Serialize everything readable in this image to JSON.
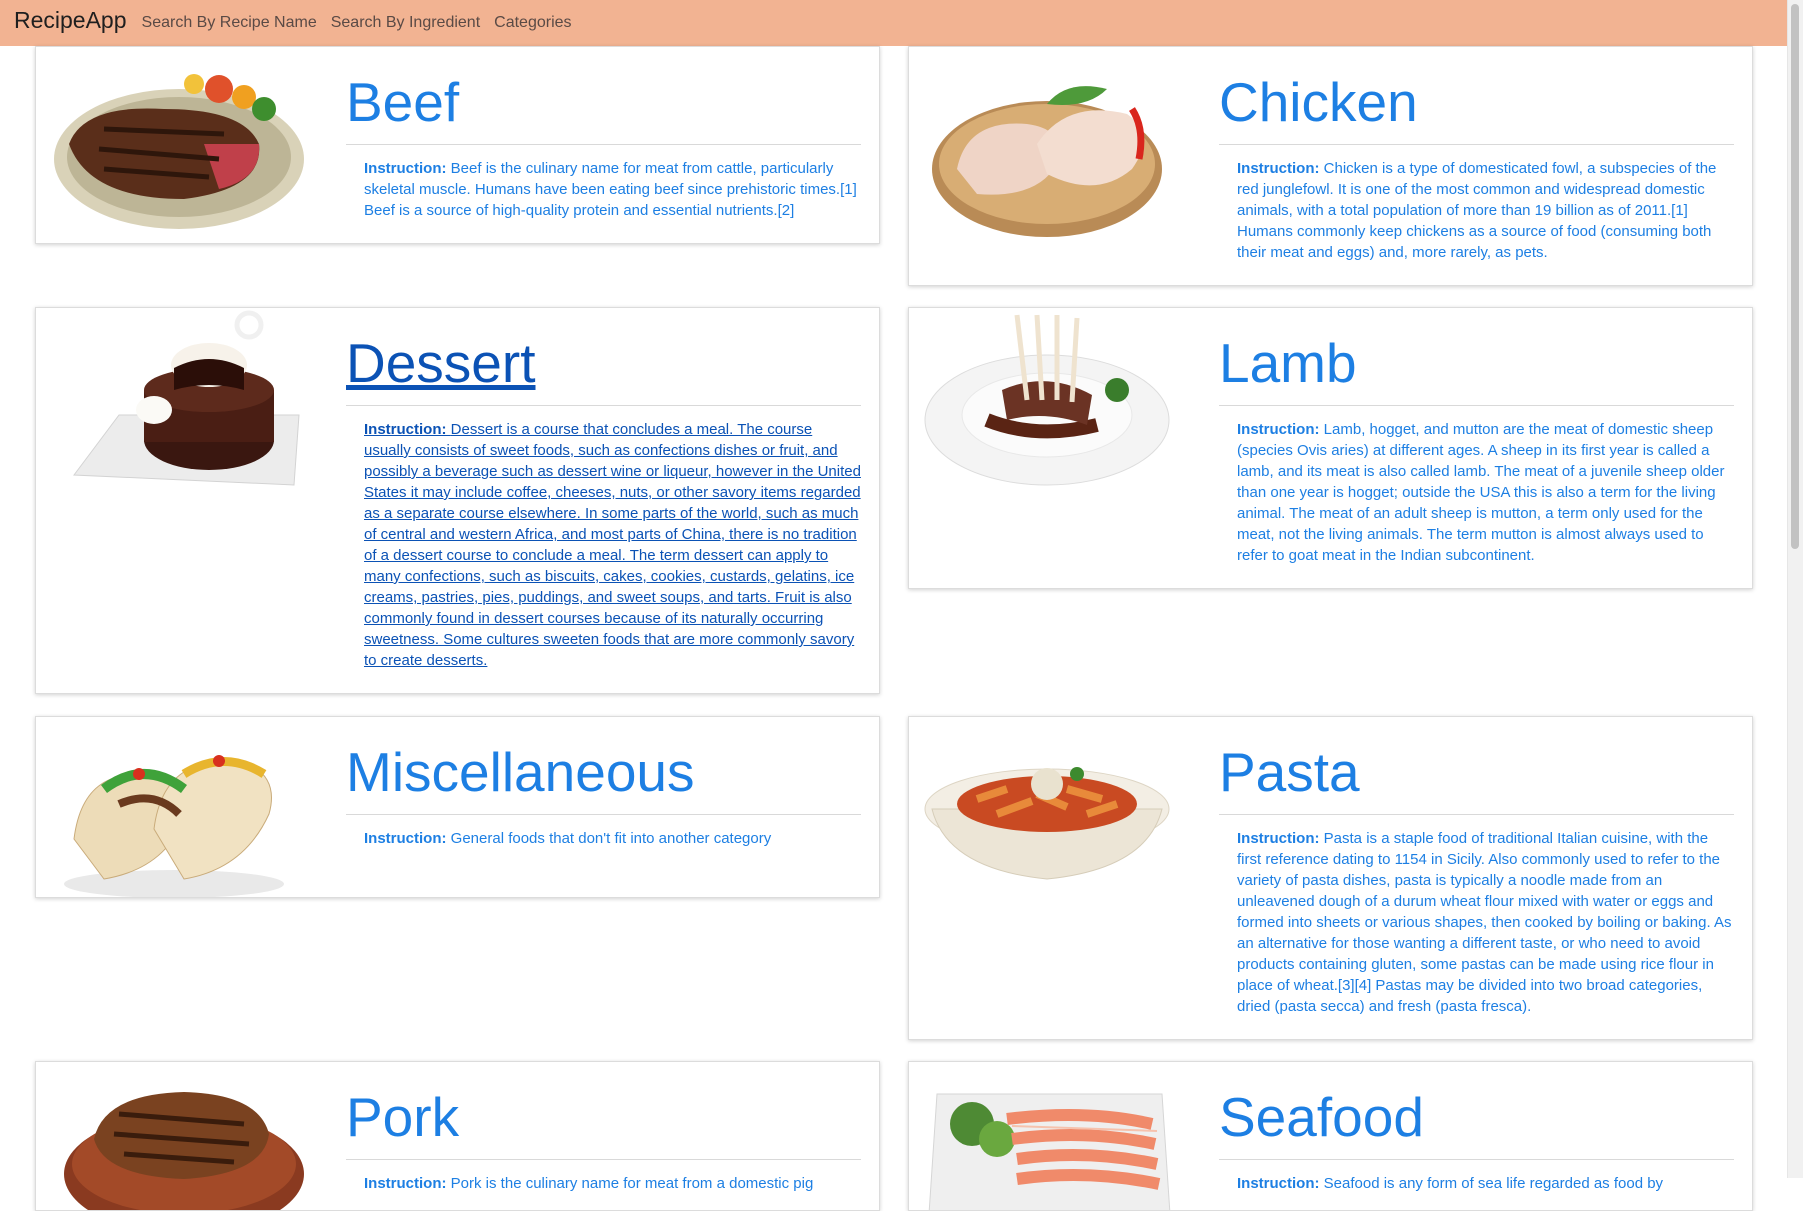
{
  "app": {
    "brand": "RecipeApp",
    "nav": [
      "Search By Recipe Name",
      "Search By Ingredient",
      "Categories"
    ]
  },
  "instruction_label": "Instruction:",
  "categories": [
    {
      "name": "Beef",
      "image_icon": "steak-plate-icon",
      "instruction": "Beef is the culinary name for meat from cattle, particularly skeletal muscle. Humans have been eating beef since prehistoric times.[1] Beef is a source of high-quality protein and essential nutrients.[2]"
    },
    {
      "name": "Chicken",
      "image_icon": "chicken-legs-icon",
      "instruction": "Chicken is a type of domesticated fowl, a subspecies of the red junglefowl. It is one of the most common and widespread domestic animals, with a total population of more than 19 billion as of 2011.[1] Humans commonly keep chickens as a source of food (consuming both their meat and eggs) and, more rarely, as pets."
    },
    {
      "name": "Dessert",
      "image_icon": "chocolate-cake-icon",
      "instruction": "Dessert is a course that concludes a meal. The course usually consists of sweet foods, such as confections dishes or fruit, and possibly a beverage such as dessert wine or liqueur, however in the United States it may include coffee, cheeses, nuts, or other savory items regarded as a separate course elsewhere. In some parts of the world, such as much of central and western Africa, and most parts of China, there is no tradition of a dessert course to conclude a meal. The term dessert can apply to many confections, such as biscuits, cakes, cookies, custards, gelatins, ice creams, pastries, pies, puddings, and sweet soups, and tarts. Fruit is also commonly found in dessert courses because of its naturally occurring sweetness. Some cultures sweeten foods that are more commonly savory to create desserts."
    },
    {
      "name": "Lamb",
      "image_icon": "lamb-rack-icon",
      "instruction": "Lamb, hogget, and mutton are the meat of domestic sheep (species Ovis aries) at different ages. A sheep in its first year is called a lamb, and its meat is also called lamb. The meat of a juvenile sheep older than one year is hogget; outside the USA this is also a term for the living animal. The meat of an adult sheep is mutton, a term only used for the meat, not the living animals. The term mutton is almost always used to refer to goat meat in the Indian subcontinent."
    },
    {
      "name": "Miscellaneous",
      "image_icon": "tacos-icon",
      "instruction": "General foods that don't fit into another category"
    },
    {
      "name": "Pasta",
      "image_icon": "pasta-bowl-icon",
      "instruction": "Pasta is a staple food of traditional Italian cuisine, with the first reference dating to 1154 in Sicily. Also commonly used to refer to the variety of pasta dishes, pasta is typically a noodle made from an unleavened dough of a durum wheat flour mixed with water or eggs and formed into sheets or various shapes, then cooked by boiling or baking. As an alternative for those wanting a different taste, or who need to avoid products containing gluten, some pastas can be made using rice flour in place of wheat.[3][4] Pastas may be divided into two broad categories, dried (pasta secca) and fresh (pasta fresca)."
    },
    {
      "name": "Pork",
      "image_icon": "pork-chop-icon",
      "instruction": "Pork is the culinary name for meat from a domestic pig"
    },
    {
      "name": "Seafood",
      "image_icon": "salmon-platter-icon",
      "instruction": "Seafood is any form of sea life regarded as food by"
    }
  ]
}
